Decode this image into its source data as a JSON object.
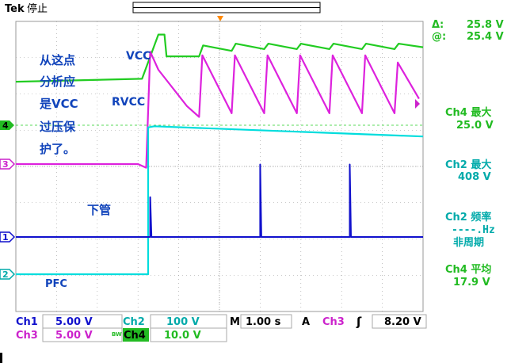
{
  "header": {
    "brand": "Tek",
    "status": "停止"
  },
  "cursor_readout": {
    "delta_label": "Δ:",
    "delta_value": "25.8 V",
    "at_label": "@:",
    "at_value": "25.4 V"
  },
  "measurements": [
    {
      "label": "Ch4 最大",
      "value": "25.0 V",
      "color": "#22bb22"
    },
    {
      "label": "Ch2 最大",
      "value": "408 V",
      "color": "#00aaaa"
    },
    {
      "label": "Ch2 频率",
      "value": "----.Hz",
      "extra": "非周期",
      "color": "#00aaaa"
    },
    {
      "label": "Ch4 平均",
      "value": "17.9 V",
      "color": "#22bb22"
    }
  ],
  "annotations": {
    "note_lines": [
      "从这点",
      "分析应",
      "是VCC",
      "过压保",
      "护了。"
    ],
    "vcc": "VCC",
    "rvcc": "RVCC",
    "low_side": "下管",
    "pfc": "PFC"
  },
  "channel_markers": [
    {
      "label": "4",
      "color": "#22bb22"
    },
    {
      "label": "3",
      "color": "#cc22cc"
    },
    {
      "label": "1",
      "color": "#1111cc"
    },
    {
      "label": "2",
      "color": "#00aaaa"
    }
  ],
  "settings": {
    "ch1": {
      "label": "Ch1",
      "value": "5.00 V"
    },
    "ch2": {
      "label": "Ch2",
      "value": "100 V"
    },
    "ch3": {
      "label": "Ch3",
      "value": "5.00 V"
    },
    "ch4": {
      "label": "Ch4",
      "value": "10.0 V",
      "bw": "BW"
    },
    "timebase": {
      "label": "M",
      "value": "1.00 s"
    },
    "trigger": {
      "label": "A",
      "source": "Ch3",
      "slope": "ʃ",
      "level": "8.20 V"
    }
  },
  "colors": {
    "ch1": "#1111cc",
    "ch2": "#00dddd",
    "ch3": "#dd22dd",
    "ch4": "#22cc22",
    "text_blue": "#1144bb",
    "trigger_marker": "#ff8800",
    "grid": "#999999"
  },
  "chart_data": {
    "type": "line",
    "time_per_division_s": 1.0,
    "divisions": {
      "x": 10,
      "y": 8
    },
    "series": [
      {
        "channel": "Ch4",
        "color": "#22cc22",
        "volts_per_division": 10.0,
        "points": [
          [
            0,
            12
          ],
          [
            3.1,
            12.8
          ],
          [
            3.5,
            25.0
          ],
          [
            3.65,
            25.0
          ],
          [
            3.7,
            19.0
          ],
          [
            4.5,
            19.0
          ],
          [
            4.6,
            22.0
          ],
          [
            5.3,
            20.5
          ],
          [
            5.4,
            22.5
          ],
          [
            6.1,
            21.0
          ],
          [
            6.2,
            22.5
          ],
          [
            6.9,
            21.0
          ],
          [
            7.0,
            22.5
          ],
          [
            7.7,
            21.0
          ],
          [
            7.8,
            22.5
          ],
          [
            8.5,
            21.0
          ],
          [
            8.6,
            22.5
          ],
          [
            9.3,
            21.0
          ],
          [
            9.4,
            22.5
          ],
          [
            10,
            21.5
          ]
        ]
      },
      {
        "channel": "Ch3",
        "color": "#dd22dd",
        "volts_per_division": 5.0,
        "points": [
          [
            0,
            0
          ],
          [
            3.0,
            0
          ],
          [
            3.2,
            -0.5
          ],
          [
            3.3,
            15.5
          ],
          [
            3.5,
            13.0
          ],
          [
            4.2,
            8.0
          ],
          [
            4.5,
            6.5
          ],
          [
            4.58,
            15.0
          ],
          [
            5.3,
            7.0
          ],
          [
            5.38,
            15.0
          ],
          [
            6.1,
            7.0
          ],
          [
            6.18,
            15.0
          ],
          [
            6.9,
            7.0
          ],
          [
            6.98,
            15.0
          ],
          [
            7.7,
            7.0
          ],
          [
            7.78,
            15.0
          ],
          [
            8.5,
            7.0
          ],
          [
            8.58,
            15.0
          ],
          [
            9.3,
            7.0
          ],
          [
            9.38,
            14.0
          ],
          [
            9.9,
            9.0
          ]
        ]
      },
      {
        "channel": "Ch2",
        "color": "#00dddd",
        "volts_per_division": 100,
        "points": [
          [
            0,
            0
          ],
          [
            3.25,
            0
          ],
          [
            3.25,
            405
          ],
          [
            3.4,
            408
          ],
          [
            10,
            380
          ]
        ]
      },
      {
        "channel": "Ch1",
        "color": "#1111cc",
        "volts_per_division": 5.0,
        "points": [
          [
            0,
            0
          ],
          [
            3.3,
            0
          ],
          [
            3.3,
            5.5
          ],
          [
            3.33,
            0
          ],
          [
            6.0,
            0
          ],
          [
            6.0,
            10.0
          ],
          [
            6.03,
            0
          ],
          [
            8.2,
            0
          ],
          [
            8.2,
            10.0
          ],
          [
            8.23,
            0
          ],
          [
            10,
            0
          ]
        ]
      }
    ]
  }
}
